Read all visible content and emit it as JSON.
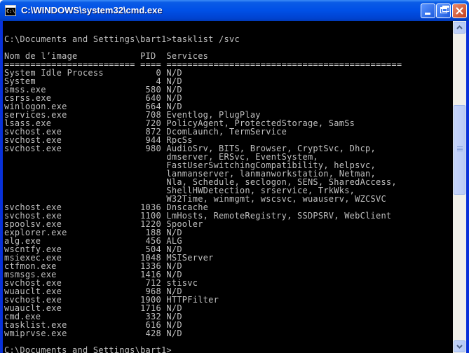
{
  "window": {
    "title": "C:\\WINDOWS\\system32\\cmd.exe",
    "icon_label": "C:\\"
  },
  "titlebar_buttons": {
    "minimize": "minimize-icon",
    "maximize": "maximize-icon",
    "close": "close-icon"
  },
  "console": {
    "lines": [
      "",
      "C:\\Documents and Settings\\bart1>tasklist /svc",
      "",
      "Nom de l’image            PID  Services",
      "========================= ==== =============================================",
      "System Idle Process          0 N/D",
      "System                       4 N/D",
      "smss.exe                   580 N/D",
      "csrss.exe                  640 N/D",
      "winlogon.exe               664 N/D",
      "services.exe               708 Eventlog, PlugPlay",
      "lsass.exe                  720 PolicyAgent, ProtectedStorage, SamSs",
      "svchost.exe                872 DcomLaunch, TermService",
      "svchost.exe                944 RpcSs",
      "svchost.exe                980 AudioSrv, BITS, Browser, CryptSvc, Dhcp,",
      "                               dmserver, ERSvc, EventSystem,",
      "                               FastUserSwitchingCompatibility, helpsvc,",
      "                               lanmanserver, lanmanworkstation, Netman,",
      "                               Nla, Schedule, seclogon, SENS, SharedAccess,",
      "                               ShellHWDetection, srservice, TrkWks,",
      "                               W32Time, winmgmt, wscsvc, wuauserv, WZCSVC",
      "svchost.exe               1036 Dnscache",
      "svchost.exe               1100 LmHosts, RemoteRegistry, SSDPSRV, WebClient",
      "spoolsv.exe               1220 Spooler",
      "explorer.exe               188 N/D",
      "alg.exe                    456 ALG",
      "wscntfy.exe                504 N/D",
      "msiexec.exe               1048 MSIServer",
      "ctfmon.exe                1336 N/D",
      "msmsgs.exe                1416 N/D",
      "svchost.exe                712 stisvc",
      "wuauclt.exe                968 N/D",
      "svchost.exe               1900 HTTPFilter",
      "wuauclt.exe               1716 N/D",
      "cmd.exe                    332 N/D",
      "tasklist.exe               616 N/D",
      "wmiprvse.exe               428 N/D",
      "",
      "C:\\Documents and Settings\\bart1>"
    ]
  },
  "colors": {
    "console_bg": "#000000",
    "console_fg": "#c0c0c0",
    "titlebar": "#0050e6"
  }
}
